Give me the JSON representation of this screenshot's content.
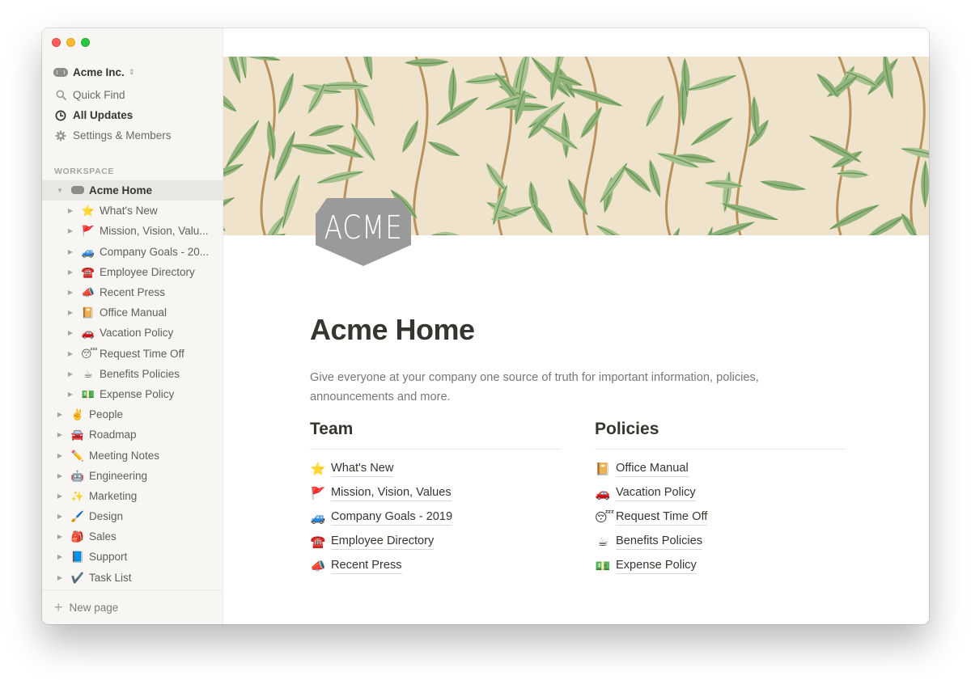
{
  "window": {
    "controls": [
      "close",
      "minimize",
      "maximize"
    ]
  },
  "sidebar": {
    "workspace_name": "Acme Inc.",
    "workspace_icon": "acme-badge-icon",
    "switcher_icon": "chevron-up-down-icon",
    "nav": [
      {
        "label": "Quick Find",
        "icon": "search-icon",
        "active": false
      },
      {
        "label": "All Updates",
        "icon": "clock-icon",
        "active": true
      },
      {
        "label": "Settings & Members",
        "icon": "gear-icon",
        "active": false
      }
    ],
    "section_label": "WORKSPACE",
    "tree": [
      {
        "label": "Acme Home",
        "emoji": "",
        "level": 0,
        "expanded": true,
        "selected": true
      },
      {
        "label": "What's New",
        "emoji": "⭐",
        "level": 1
      },
      {
        "label": "Mission, Vision, Valu...",
        "emoji": "🚩",
        "level": 1
      },
      {
        "label": "Company Goals - 20...",
        "emoji": "🚙",
        "level": 1
      },
      {
        "label": "Employee Directory",
        "emoji": "☎️",
        "level": 1
      },
      {
        "label": "Recent Press",
        "emoji": "📣",
        "level": 1
      },
      {
        "label": "Office Manual",
        "emoji": "📔",
        "level": 1
      },
      {
        "label": "Vacation Policy",
        "emoji": "🚗",
        "level": 1
      },
      {
        "label": "Request Time Off",
        "emoji": "😴",
        "level": 1
      },
      {
        "label": "Benefits Policies",
        "emoji": "☕",
        "level": 1
      },
      {
        "label": "Expense Policy",
        "emoji": "💵",
        "level": 1
      },
      {
        "label": "People",
        "emoji": "✌️",
        "level": 0
      },
      {
        "label": "Roadmap",
        "emoji": "🚘",
        "level": 0
      },
      {
        "label": "Meeting Notes",
        "emoji": "✏️",
        "level": 0
      },
      {
        "label": "Engineering",
        "emoji": "🤖",
        "level": 0
      },
      {
        "label": "Marketing",
        "emoji": "✨",
        "level": 0
      },
      {
        "label": "Design",
        "emoji": "🖌️",
        "level": 0
      },
      {
        "label": "Sales",
        "emoji": "🎒",
        "level": 0
      },
      {
        "label": "Support",
        "emoji": "📘",
        "level": 0
      },
      {
        "label": "Task List",
        "emoji": "✔️",
        "level": 0
      }
    ],
    "new_page_label": "New page"
  },
  "page": {
    "cover": "willow-leaf-pattern",
    "logo_text": "ACME",
    "title": "Acme Home",
    "description": "Give everyone at your company one source of truth for important information, policies, announcements and more.",
    "columns": [
      {
        "heading": "Team",
        "links": [
          {
            "emoji": "⭐",
            "label": "What's New"
          },
          {
            "emoji": "🚩",
            "label": "Mission, Vision, Values"
          },
          {
            "emoji": "🚙",
            "label": "Company Goals - 2019"
          },
          {
            "emoji": "☎️",
            "label": "Employee Directory"
          },
          {
            "emoji": "📣",
            "label": "Recent Press"
          }
        ]
      },
      {
        "heading": "Policies",
        "links": [
          {
            "emoji": "📔",
            "label": "Office Manual"
          },
          {
            "emoji": "🚗",
            "label": "Vacation Policy"
          },
          {
            "emoji": "😴",
            "label": "Request Time Off"
          },
          {
            "emoji": "☕",
            "label": "Benefits Policies"
          },
          {
            "emoji": "💵",
            "label": "Expense Policy"
          }
        ]
      }
    ]
  },
  "colors": {
    "sidebar_bg": "#f7f6f3",
    "text": "#37352f",
    "muted": "#787774",
    "cover_bg": "#efe3cb",
    "leaf": "#8fb37a",
    "leaf_dark": "#5f8f4e",
    "branch": "#b8925a",
    "logo": "#9a9a9a"
  }
}
